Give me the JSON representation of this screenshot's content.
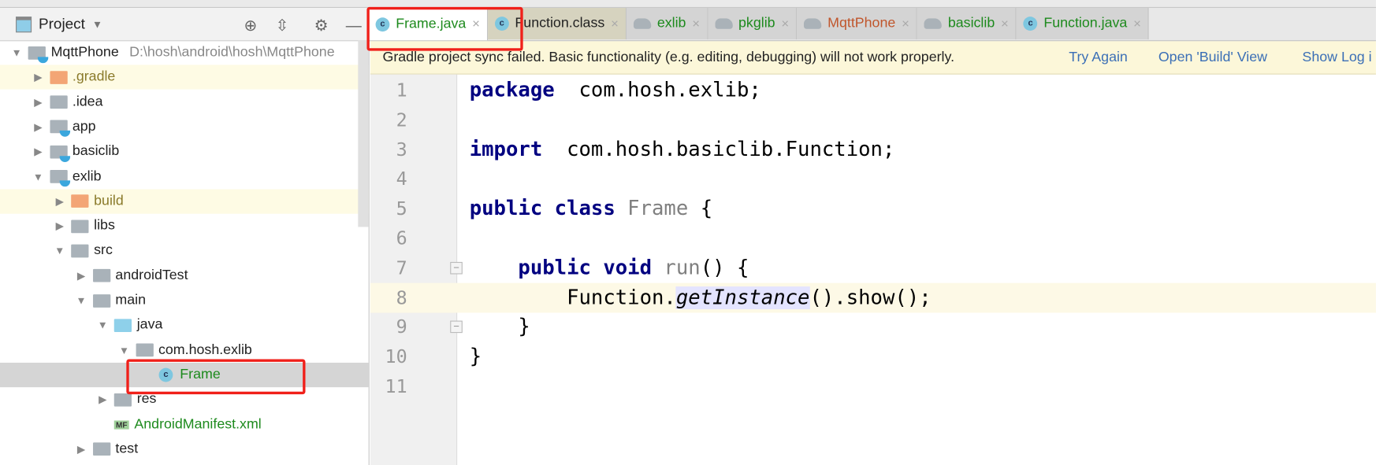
{
  "project_panel": {
    "title": "Project",
    "tree": [
      {
        "label": "MqttPhone",
        "path": "D:\\hosh\\android\\hosh\\MqttPhone",
        "depth": 0,
        "expanded": true,
        "icon": "module-folder"
      },
      {
        "label": ".gradle",
        "depth": 1,
        "expanded": false,
        "icon": "excluded-folder"
      },
      {
        "label": ".idea",
        "depth": 1,
        "expanded": false,
        "icon": "folder"
      },
      {
        "label": "app",
        "depth": 1,
        "expanded": false,
        "icon": "module-folder"
      },
      {
        "label": "basiclib",
        "depth": 1,
        "expanded": false,
        "icon": "module-folder"
      },
      {
        "label": "exlib",
        "depth": 1,
        "expanded": true,
        "icon": "module-folder"
      },
      {
        "label": "build",
        "depth": 2,
        "expanded": false,
        "icon": "excluded-folder"
      },
      {
        "label": "libs",
        "depth": 2,
        "expanded": false,
        "icon": "folder"
      },
      {
        "label": "src",
        "depth": 2,
        "expanded": true,
        "icon": "folder"
      },
      {
        "label": "androidTest",
        "depth": 3,
        "expanded": false,
        "icon": "folder"
      },
      {
        "label": "main",
        "depth": 3,
        "expanded": true,
        "icon": "folder"
      },
      {
        "label": "java",
        "depth": 4,
        "expanded": true,
        "icon": "source-folder"
      },
      {
        "label": "com.hosh.exlib",
        "depth": 5,
        "expanded": true,
        "icon": "package"
      },
      {
        "label": "Frame",
        "depth": 6,
        "icon": "class",
        "selected": true
      },
      {
        "label": "res",
        "depth": 4,
        "expanded": false,
        "icon": "resource-folder"
      },
      {
        "label": "AndroidManifest.xml",
        "depth": 4,
        "icon": "manifest"
      },
      {
        "label": "test",
        "depth": 3,
        "expanded": false,
        "icon": "folder"
      }
    ]
  },
  "tabs": [
    {
      "label": "Frame.java",
      "icon": "class-icon",
      "active": true,
      "color": "#1d8a1d"
    },
    {
      "label": "Function.class",
      "icon": "class-icon",
      "color": "#222222"
    },
    {
      "label": "exlib",
      "icon": "gradle-icon",
      "color": "#1d8a1d"
    },
    {
      "label": "pkglib",
      "icon": "gradle-icon",
      "color": "#1d8a1d"
    },
    {
      "label": "MqttPhone",
      "icon": "gradle-icon",
      "color": "#c0562c"
    },
    {
      "label": "basiclib",
      "icon": "gradle-icon",
      "color": "#1d8a1d"
    },
    {
      "label": "Function.java",
      "icon": "class-icon",
      "color": "#1d8a1d"
    }
  ],
  "notification": {
    "message": "Gradle project sync failed. Basic functionality (e.g. editing, debugging) will not work properly.",
    "actions": [
      "Try Again",
      "Open 'Build' View",
      "Show Log i"
    ]
  },
  "editor": {
    "current_line": 8,
    "lines": [
      [
        [
          "kw",
          "package"
        ],
        [
          "",
          "  com.hosh.exlib;"
        ]
      ],
      [],
      [
        [
          "kw",
          "import"
        ],
        [
          "",
          "  com.hosh.basiclib.Function;"
        ]
      ],
      [],
      [
        [
          "kw",
          "public class"
        ],
        [
          "gray",
          " Frame"
        ],
        [
          "",
          " {"
        ]
      ],
      [],
      [
        [
          "",
          "    "
        ],
        [
          "kw",
          "public void"
        ],
        [
          "gray",
          " run"
        ],
        [
          "",
          "() {"
        ]
      ],
      [
        [
          "",
          "        Function."
        ],
        [
          "it",
          "getInstance"
        ],
        [
          "",
          "().show();"
        ]
      ],
      [
        [
          "",
          "    }"
        ]
      ],
      [
        [
          "",
          "}"
        ]
      ],
      []
    ]
  },
  "colors": {
    "keyword": "#000080",
    "highlight": "#f0201a",
    "notification_bg": "#fcf7d9",
    "link": "#3b6fb6"
  }
}
